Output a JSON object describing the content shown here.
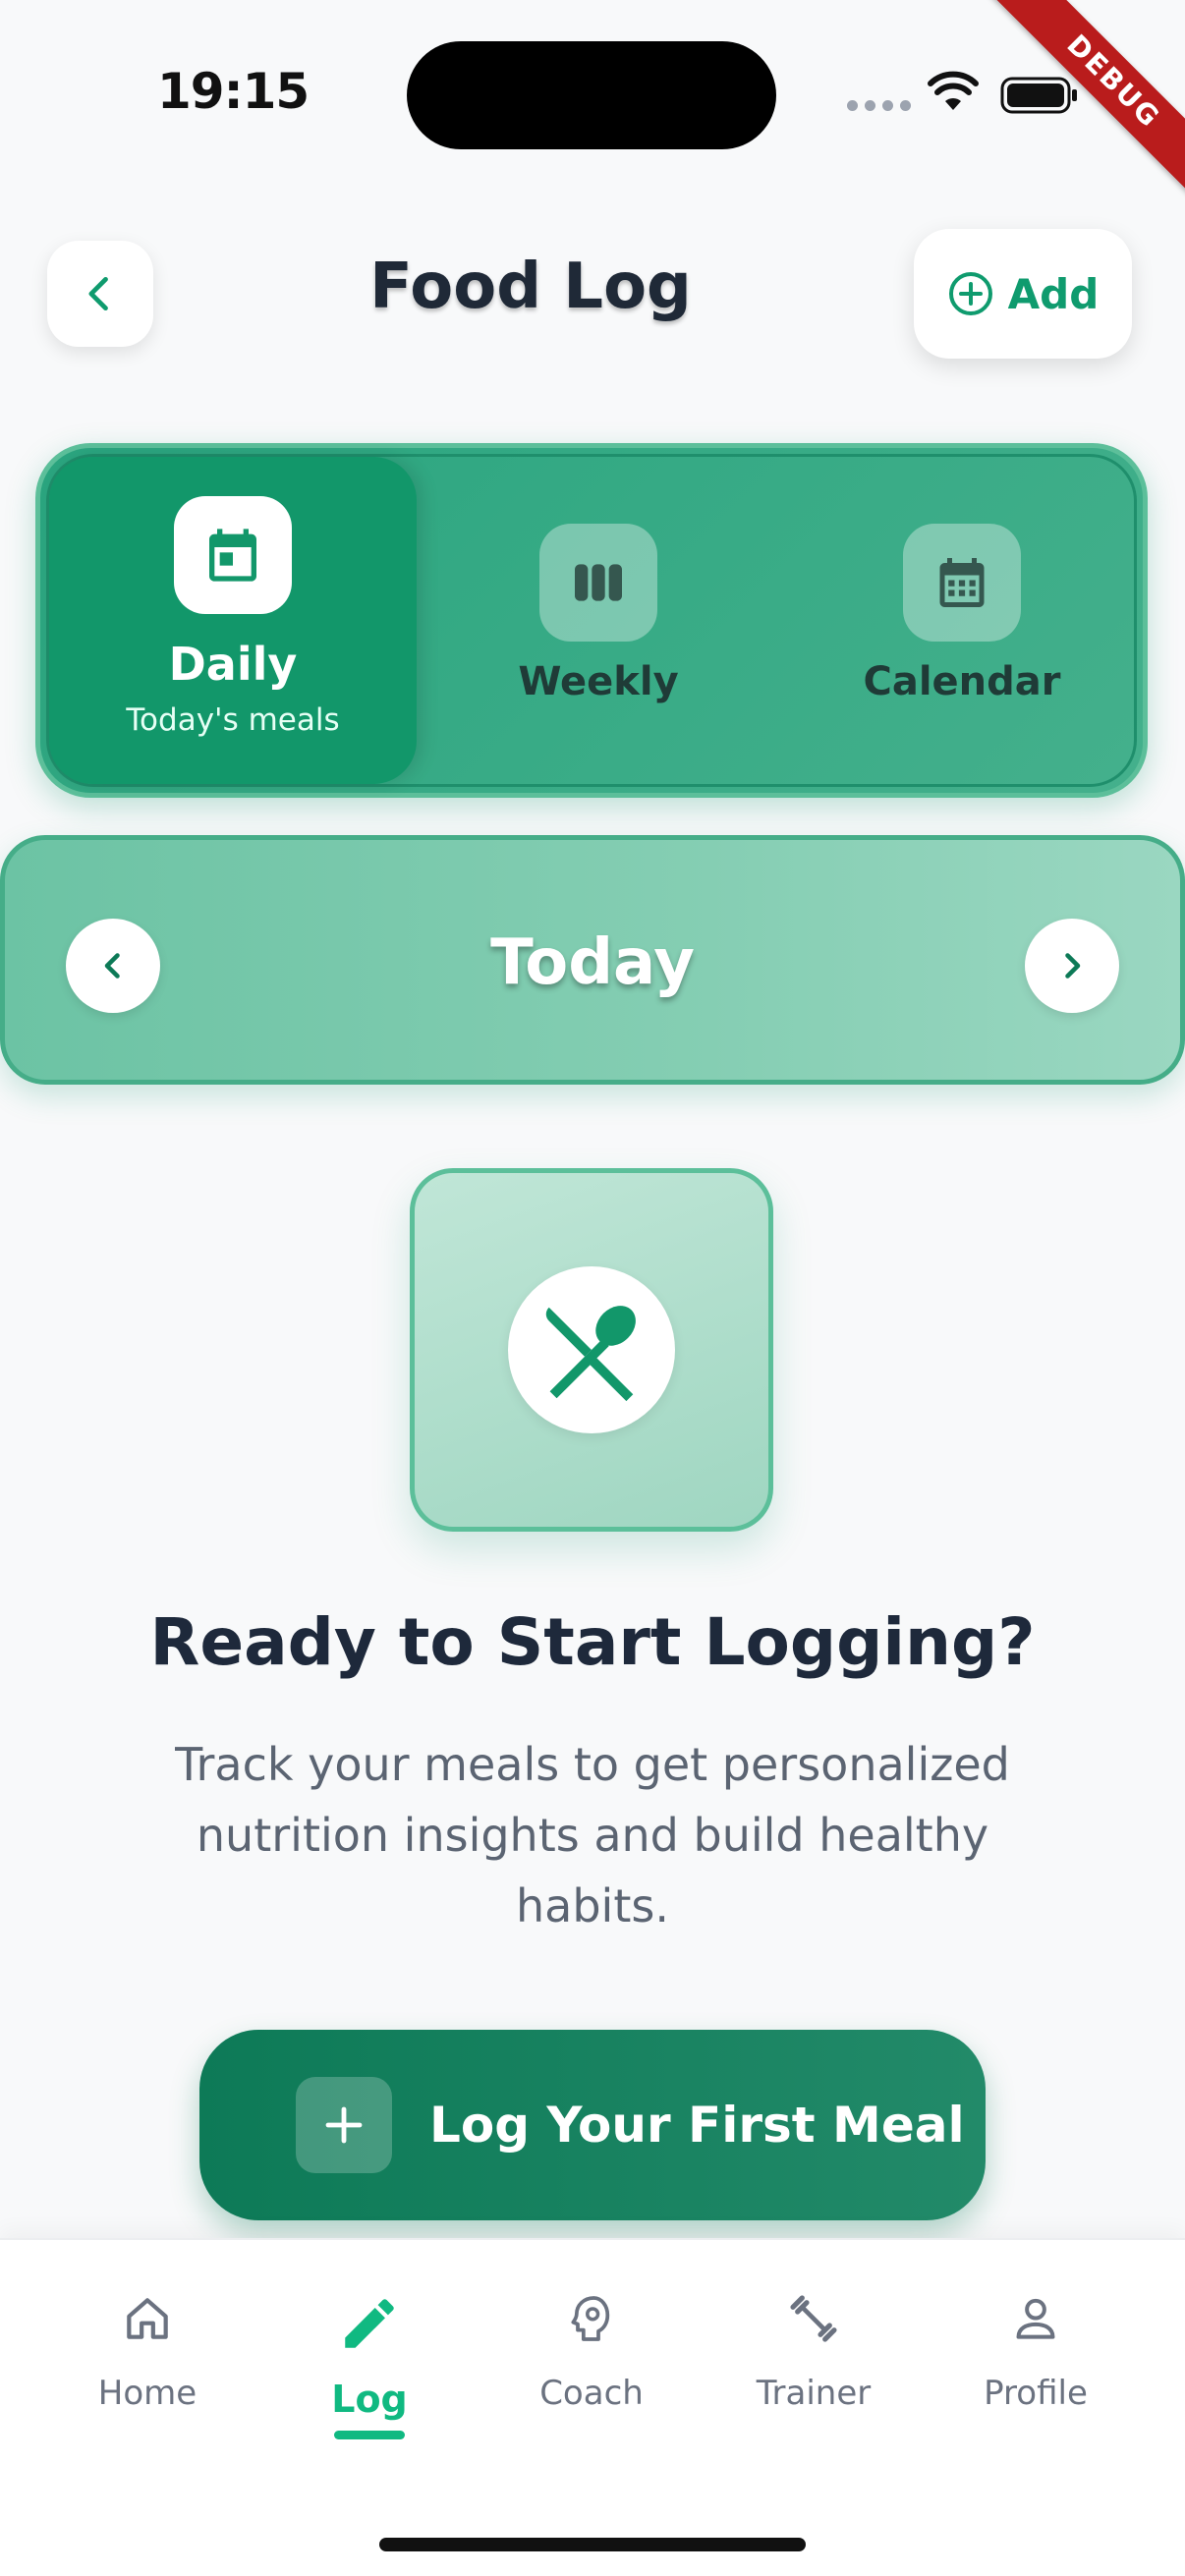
{
  "status_bar": {
    "time": "19:15",
    "debug_badge": "DEBUG"
  },
  "header": {
    "title": "Food Log",
    "add_label": "Add"
  },
  "view_switch": {
    "selected": "daily",
    "items": [
      {
        "id": "daily",
        "label": "Daily",
        "sublabel": "Today's meals",
        "icon": "calendar-today-icon"
      },
      {
        "id": "weekly",
        "label": "Weekly",
        "icon": "view-week-icon"
      },
      {
        "id": "calendar",
        "label": "Calendar",
        "icon": "calendar-month-icon"
      }
    ]
  },
  "date_nav": {
    "label": "Today"
  },
  "empty_state": {
    "icon": "restaurant-icon",
    "title": "Ready to Start Logging?",
    "description": "Track your meals to get personalized nutrition insights and build healthy habits.",
    "cta_label": "Log Your First Meal"
  },
  "bottom_nav": {
    "active": "log",
    "items": [
      {
        "id": "home",
        "label": "Home",
        "icon": "home-icon"
      },
      {
        "id": "log",
        "label": "Log",
        "icon": "edit-pencil-icon"
      },
      {
        "id": "coach",
        "label": "Coach",
        "icon": "brain-head-icon"
      },
      {
        "id": "trainer",
        "label": "Trainer",
        "icon": "dumbbell-icon"
      },
      {
        "id": "profile",
        "label": "Profile",
        "icon": "person-icon"
      }
    ]
  },
  "colors": {
    "accent": "#10b981",
    "primary_dark": "#0d7a57",
    "text_dark": "#1e293b",
    "text_muted": "#5b6472",
    "debug": "#b91c1c"
  }
}
